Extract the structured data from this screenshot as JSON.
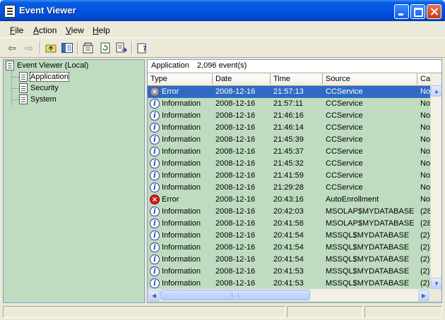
{
  "window": {
    "title": "Event Viewer"
  },
  "menu": [
    "File",
    "Action",
    "View",
    "Help"
  ],
  "toolbar": {
    "icons": [
      "back-icon",
      "forward-icon",
      "up-folder-icon",
      "show-hide-tree-icon",
      "properties-icon",
      "refresh-icon",
      "export-list-icon",
      "help-icon"
    ]
  },
  "tree": {
    "root": "Event Viewer (Local)",
    "children": [
      "Application",
      "Security",
      "System"
    ],
    "selected": "Application"
  },
  "pane": {
    "log_name": "Application",
    "event_count": "2,096 event(s)"
  },
  "columns": [
    "Type",
    "Date",
    "Time",
    "Source",
    "Ca"
  ],
  "rows": [
    {
      "type": "Error",
      "date": "2008-12-16",
      "time": "21:57:13",
      "source": "CCService",
      "category": "No",
      "icon": "error-icon"
    },
    {
      "type": "Information",
      "date": "2008-12-16",
      "time": "21:57:11",
      "source": "CCService",
      "category": "No",
      "icon": "info-icon"
    },
    {
      "type": "Information",
      "date": "2008-12-16",
      "time": "21:46:16",
      "source": "CCService",
      "category": "No",
      "icon": "info-icon"
    },
    {
      "type": "Information",
      "date": "2008-12-16",
      "time": "21:46:14",
      "source": "CCService",
      "category": "No",
      "icon": "info-icon"
    },
    {
      "type": "Information",
      "date": "2008-12-16",
      "time": "21:45:39",
      "source": "CCService",
      "category": "No",
      "icon": "info-icon"
    },
    {
      "type": "Information",
      "date": "2008-12-16",
      "time": "21:45:37",
      "source": "CCService",
      "category": "No",
      "icon": "info-icon"
    },
    {
      "type": "Information",
      "date": "2008-12-16",
      "time": "21:45:32",
      "source": "CCService",
      "category": "No",
      "icon": "info-icon"
    },
    {
      "type": "Information",
      "date": "2008-12-16",
      "time": "21:41:59",
      "source": "CCService",
      "category": "No",
      "icon": "info-icon"
    },
    {
      "type": "Information",
      "date": "2008-12-16",
      "time": "21:29:28",
      "source": "CCService",
      "category": "No",
      "icon": "info-icon"
    },
    {
      "type": "Error",
      "date": "2008-12-16",
      "time": "20:43:16",
      "source": "AutoEnrollment",
      "category": "No",
      "icon": "error-icon"
    },
    {
      "type": "Information",
      "date": "2008-12-16",
      "time": "20:42:03",
      "source": "MSOLAP$MYDATABASE",
      "category": "(28",
      "icon": "info-icon"
    },
    {
      "type": "Information",
      "date": "2008-12-16",
      "time": "20:41:58",
      "source": "MSOLAP$MYDATABASE",
      "category": "(28",
      "icon": "info-icon"
    },
    {
      "type": "Information",
      "date": "2008-12-16",
      "time": "20:41:54",
      "source": "MSSQL$MYDATABASE",
      "category": "(2)",
      "icon": "info-icon"
    },
    {
      "type": "Information",
      "date": "2008-12-16",
      "time": "20:41:54",
      "source": "MSSQL$MYDATABASE",
      "category": "(2)",
      "icon": "info-icon"
    },
    {
      "type": "Information",
      "date": "2008-12-16",
      "time": "20:41:54",
      "source": "MSSQL$MYDATABASE",
      "category": "(2)",
      "icon": "info-icon"
    },
    {
      "type": "Information",
      "date": "2008-12-16",
      "time": "20:41:53",
      "source": "MSSQL$MYDATABASE",
      "category": "(2)",
      "icon": "info-icon"
    },
    {
      "type": "Information",
      "date": "2008-12-16",
      "time": "20:41:53",
      "source": "MSSQL$MYDATABASE",
      "category": "(2)",
      "icon": "info-icon"
    }
  ],
  "selected_row": 0,
  "colors": {
    "list_background": "#C0DCC0",
    "selection": "#316AC5",
    "titlebar": "#0054E3"
  }
}
